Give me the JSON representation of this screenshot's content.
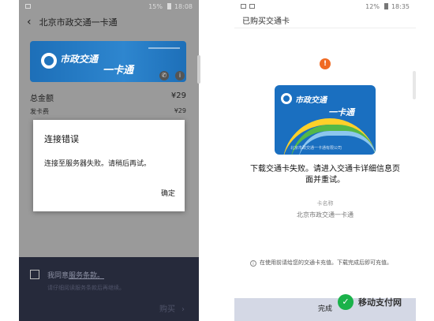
{
  "left_phone": {
    "status": {
      "battery": "15%",
      "time": "18:08"
    },
    "header": {
      "title": "北京市政交通一卡通"
    },
    "card": {
      "brand": "市政交通",
      "brand2": "一卡通"
    },
    "total": {
      "label": "总金额",
      "value": "¥29"
    },
    "fee": {
      "label": "发卡费",
      "value": "¥29"
    },
    "agree": {
      "prefix": "我同意",
      "link": "服务条款。",
      "hint": "请仔细阅读服务条款后再继续。"
    },
    "buy_label": "购买",
    "dialog": {
      "title": "连接错误",
      "message": "连接至服务器失败。请稍后再试。",
      "ok": "确定"
    }
  },
  "right_phone": {
    "status": {
      "battery": "12%",
      "time": "18:35"
    },
    "header": {
      "title": "已购买交通卡"
    },
    "card": {
      "brand": "市政交通",
      "brand2": "一卡通",
      "issuer": "北京市政交通一卡通有限公司"
    },
    "error": "下载交通卡失败。请进入交通卡详细信息页面并重试。",
    "card_name_label": "卡名称",
    "card_name_value": "北京市政交通一卡通",
    "info": "在使用前请给您的交通卡充值。下载完成后即可充值。",
    "done": "完成"
  },
  "watermark": {
    "text": "移动支付网"
  },
  "colors": {
    "card_blue": "#1a6fc0",
    "alert_orange": "#f06a23",
    "bottom_bar": "#262a3b"
  }
}
